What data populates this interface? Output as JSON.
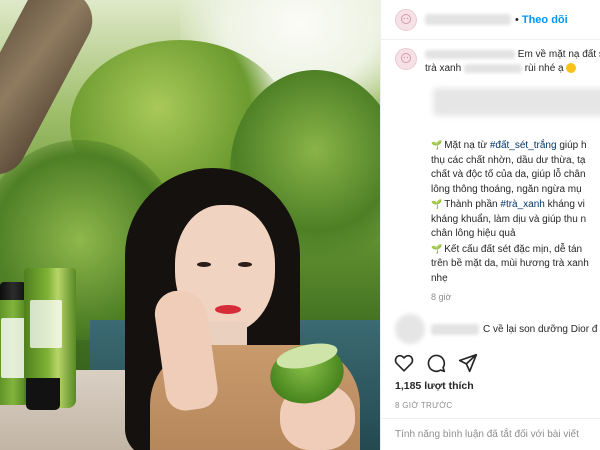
{
  "post": {
    "follow_label": "Theo dõi",
    "header_dot": "•",
    "caption": {
      "text_start": "Em về mặt nạ đất s",
      "text_line2_start": "trà xanh",
      "text_line2_end": "rùi nhé ạ"
    },
    "body_lines": [
      {
        "icon": "leaf-icon",
        "parts": [
          "Mặt nạ từ ",
          "#đất_sét_trắng",
          " giúp h"
        ]
      },
      {
        "icon": "",
        "parts": [
          "thụ các chất nhờn, dầu dư thừa, tạ"
        ]
      },
      {
        "icon": "",
        "parts": [
          "chất và độc tố của da, giúp lỗ chân"
        ]
      },
      {
        "icon": "",
        "parts": [
          "lông thông thoáng, ngăn ngừa mụ"
        ]
      },
      {
        "icon": "leaf-icon",
        "parts": [
          "Thành phần ",
          "#trà_xanh",
          " kháng vi"
        ]
      },
      {
        "icon": "",
        "parts": [
          "kháng khuẩn, làm dịu và giúp thu n"
        ]
      },
      {
        "icon": "",
        "parts": [
          "chân lông hiệu quả"
        ]
      },
      {
        "icon": "leaf-icon",
        "parts": [
          "Kết cấu đất sét đặc mịn, dễ tán"
        ]
      },
      {
        "icon": "",
        "parts": [
          "trên bề mặt da, mùi hương trà xanh"
        ]
      },
      {
        "icon": "",
        "parts": [
          "nhẹ"
        ]
      }
    ],
    "caption_time": "8 giờ",
    "comment2_text": "C về lại son dưỡng Dior đ",
    "likes": "1,185 lượt thích",
    "post_time": "8 GIỜ TRƯỚC",
    "comments_disabled": "Tính năng bình luận đã tắt đối với bài viết"
  },
  "icons": {
    "like": "heart-icon",
    "comment": "comment-icon",
    "share": "share-icon",
    "avatar": "avatar-icon"
  },
  "colors": {
    "follow_blue": "#0095f6",
    "hashtag": "#00376b",
    "muted": "#8e8e8e",
    "leaf_green": "#4caf50"
  }
}
